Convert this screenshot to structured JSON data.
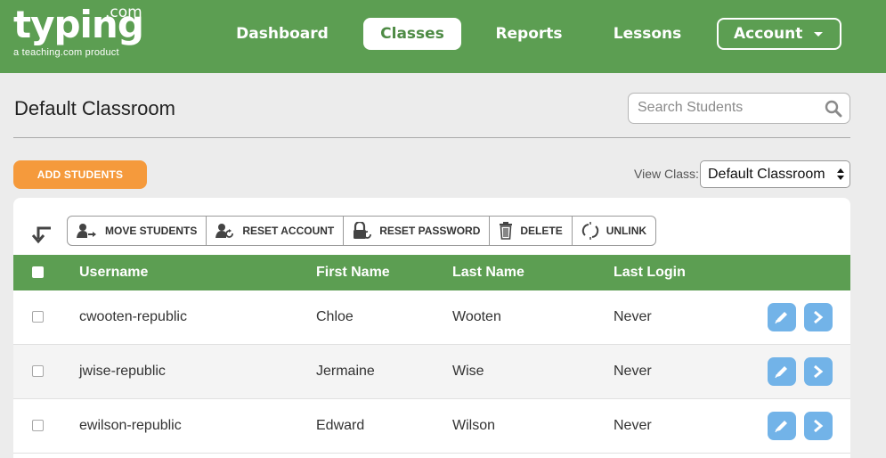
{
  "brand": {
    "name": "typing",
    "suffix": ".com",
    "tagline": "a teaching.com product"
  },
  "nav": {
    "dashboard": "Dashboard",
    "classes": "Classes",
    "reports": "Reports",
    "lessons": "Lessons",
    "account": "Account"
  },
  "page": {
    "title": "Default Classroom"
  },
  "search": {
    "placeholder": "Search Students"
  },
  "add_students_label": "ADD STUDENTS",
  "view_class": {
    "label": "View Class:",
    "selected": "Default Classroom"
  },
  "toolbar": {
    "move": "MOVE STUDENTS",
    "reset_account": "RESET ACCOUNT",
    "reset_password": "RESET PASSWORD",
    "delete": "DELETE",
    "unlink": "UNLINK"
  },
  "table": {
    "headers": {
      "username": "Username",
      "first_name": "First Name",
      "last_name": "Last Name",
      "last_login": "Last Login"
    },
    "rows": [
      {
        "username": "cwooten-republic",
        "first_name": "Chloe",
        "last_name": "Wooten",
        "last_login": "Never"
      },
      {
        "username": "jwise-republic",
        "first_name": "Jermaine",
        "last_name": "Wise",
        "last_login": "Never"
      },
      {
        "username": "ewilson-republic",
        "first_name": "Edward",
        "last_name": "Wilson",
        "last_login": "Never"
      }
    ]
  },
  "colors": {
    "brand_green": "#5c9e52",
    "add_orange": "#f59a3c",
    "action_blue": "#72b3e8"
  },
  "icons": {
    "search": "search-icon",
    "back": "back-arrow-icon",
    "move": "user-move-icon",
    "reset_account": "user-reset-icon",
    "reset_password": "lock-reset-icon",
    "delete": "trash-icon",
    "unlink": "unlink-icon",
    "edit": "pencil-icon",
    "open": "chevron-right-icon"
  }
}
